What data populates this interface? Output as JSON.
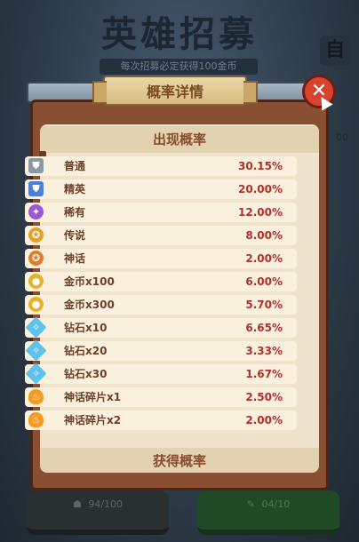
{
  "background": {
    "title": "英雄招募",
    "subtitle": "每次招募必定获得100金币",
    "side_tab": "自",
    "side_value": "00",
    "left_button": "94/100",
    "right_button": "04/10"
  },
  "modal": {
    "title": "概率详情",
    "section_appearance": "出现概率",
    "section_obtain": "获得概率",
    "rows": [
      {
        "icon": "shield-gray-icon",
        "glyph": "⛊",
        "cls": "ordinary",
        "name": "普通",
        "value": "30.15%"
      },
      {
        "icon": "shield-blue-icon",
        "glyph": "⛊",
        "cls": "elite",
        "name": "精英",
        "value": "20.00%"
      },
      {
        "icon": "gem-purple-icon",
        "glyph": "✦",
        "cls": "rare",
        "name": "稀有",
        "value": "12.00%"
      },
      {
        "icon": "medal-gold-icon",
        "glyph": "✪",
        "cls": "legend",
        "name": "传说",
        "value": "8.00%"
      },
      {
        "icon": "medal-orange-icon",
        "glyph": "✪",
        "cls": "myth",
        "name": "神话",
        "value": "2.00%"
      },
      {
        "icon": "coin-icon",
        "glyph": "●",
        "cls": "coin",
        "name": "金币x100",
        "value": "6.00%"
      },
      {
        "icon": "coin-icon",
        "glyph": "●",
        "cls": "coin",
        "name": "金币x300",
        "value": "5.70%"
      },
      {
        "icon": "diamond-icon",
        "glyph": "✧",
        "cls": "diamond",
        "name": "钻石x10",
        "value": "6.65%"
      },
      {
        "icon": "diamond-icon",
        "glyph": "✧",
        "cls": "diamond",
        "name": "钻石x20",
        "value": "3.33%"
      },
      {
        "icon": "diamond-icon",
        "glyph": "✧",
        "cls": "diamond",
        "name": "钻石x30",
        "value": "1.67%"
      },
      {
        "icon": "flame-fragment-icon",
        "glyph": "♨",
        "cls": "frag",
        "name": "神话碎片x1",
        "value": "2.50%"
      },
      {
        "icon": "flame-fragment-icon",
        "glyph": "♨",
        "cls": "frag",
        "name": "神话碎片x2",
        "value": "2.00%"
      }
    ]
  },
  "close_label": "✕"
}
